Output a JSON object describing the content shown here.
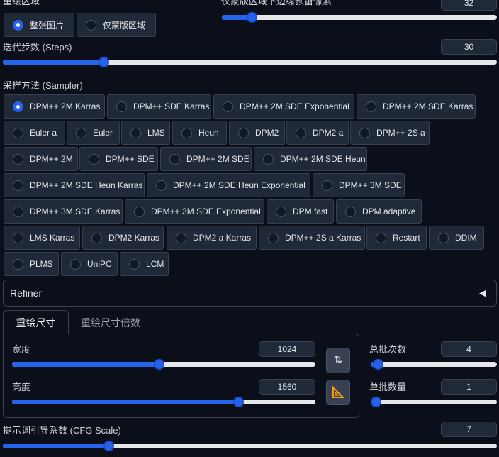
{
  "top_partial": {
    "area_label": "重绘区域",
    "area_options": [
      "整张图片",
      "仅蒙版区域"
    ],
    "area_selected": "整张图片",
    "padding_label": "仅蒙版区域下边缘预留像素",
    "padding_value": "32"
  },
  "steps": {
    "label": "迭代步数 (Steps)",
    "value": "30"
  },
  "sampler": {
    "label": "采样方法 (Sampler)",
    "selected": "DPM++ 2M Karras",
    "options": [
      "DPM++ 2M Karras",
      "DPM++ SDE Karras",
      "DPM++ 2M SDE Exponential",
      "DPM++ 2M SDE Karras",
      "Euler a",
      "Euler",
      "LMS",
      "Heun",
      "DPM2",
      "DPM2 a",
      "DPM++ 2S a",
      "DPM++ 2M",
      "DPM++ SDE",
      "DPM++ 2M SDE",
      "DPM++ 2M SDE Heun",
      "DPM++ 2M SDE Heun Karras",
      "DPM++ 2M SDE Heun Exponential",
      "DPM++ 3M SDE",
      "DPM++ 3M SDE Karras",
      "DPM++ 3M SDE Exponential",
      "DPM fast",
      "DPM adaptive",
      "LMS Karras",
      "DPM2 Karras",
      "DPM2 a Karras",
      "DPM++ 2S a Karras",
      "Restart",
      "DDIM",
      "PLMS",
      "UniPC",
      "LCM"
    ]
  },
  "refiner": {
    "label": "Refiner",
    "caret": "◀"
  },
  "tabs": [
    {
      "label": "重绘尺寸"
    },
    {
      "label": "重绘尺寸倍数"
    }
  ],
  "width": {
    "label": "宽度",
    "value": "1024"
  },
  "height": {
    "label": "高度",
    "value": "1560"
  },
  "swap_icon": "⇅",
  "ratio_icon": "📐",
  "batch_count": {
    "label": "总批次数",
    "value": "4"
  },
  "batch_size": {
    "label": "单批数量",
    "value": "1"
  },
  "cfg": {
    "label": "提示词引导系数 (CFG Scale)",
    "value": "7"
  },
  "colors": {
    "accent": "#2563eb",
    "bg": "#0b0f19",
    "panel": "#1f2937"
  }
}
